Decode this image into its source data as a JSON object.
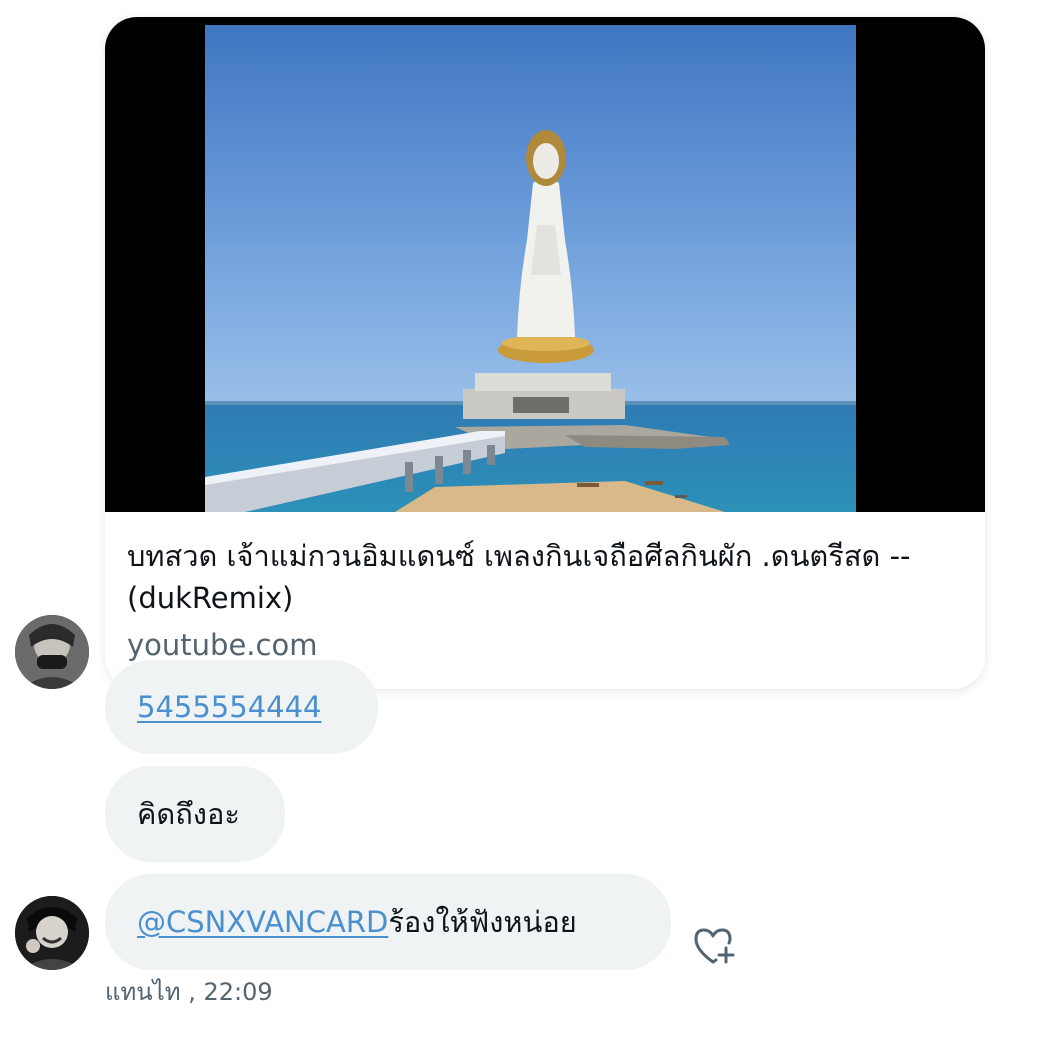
{
  "link_card": {
    "title": "บทสวด เจ้าแม่กวนอิมแดนซ์ เพลงกินเจถือศีลกินผัก .ดนตรีสด -- (dukRemix)",
    "domain": "youtube.com",
    "thumbnail_icon": "guanyin-statue-seaside-photo"
  },
  "messages": [
    {
      "link_text": "5455554444"
    },
    {
      "text": "คิดถึงอะ"
    },
    {
      "mention": "@CSNXVANCARD",
      "text": " ร้องให้ฟังหน่อย"
    }
  ],
  "meta": {
    "sender_time": "แทนไท , 22:09"
  },
  "icons": {
    "react": "heart-plus-icon",
    "avatar_1": "user-avatar",
    "avatar_2": "user-avatar"
  },
  "colors": {
    "bubble": "#eff3f4",
    "link": "#4a8fd0",
    "muted": "#536471"
  }
}
